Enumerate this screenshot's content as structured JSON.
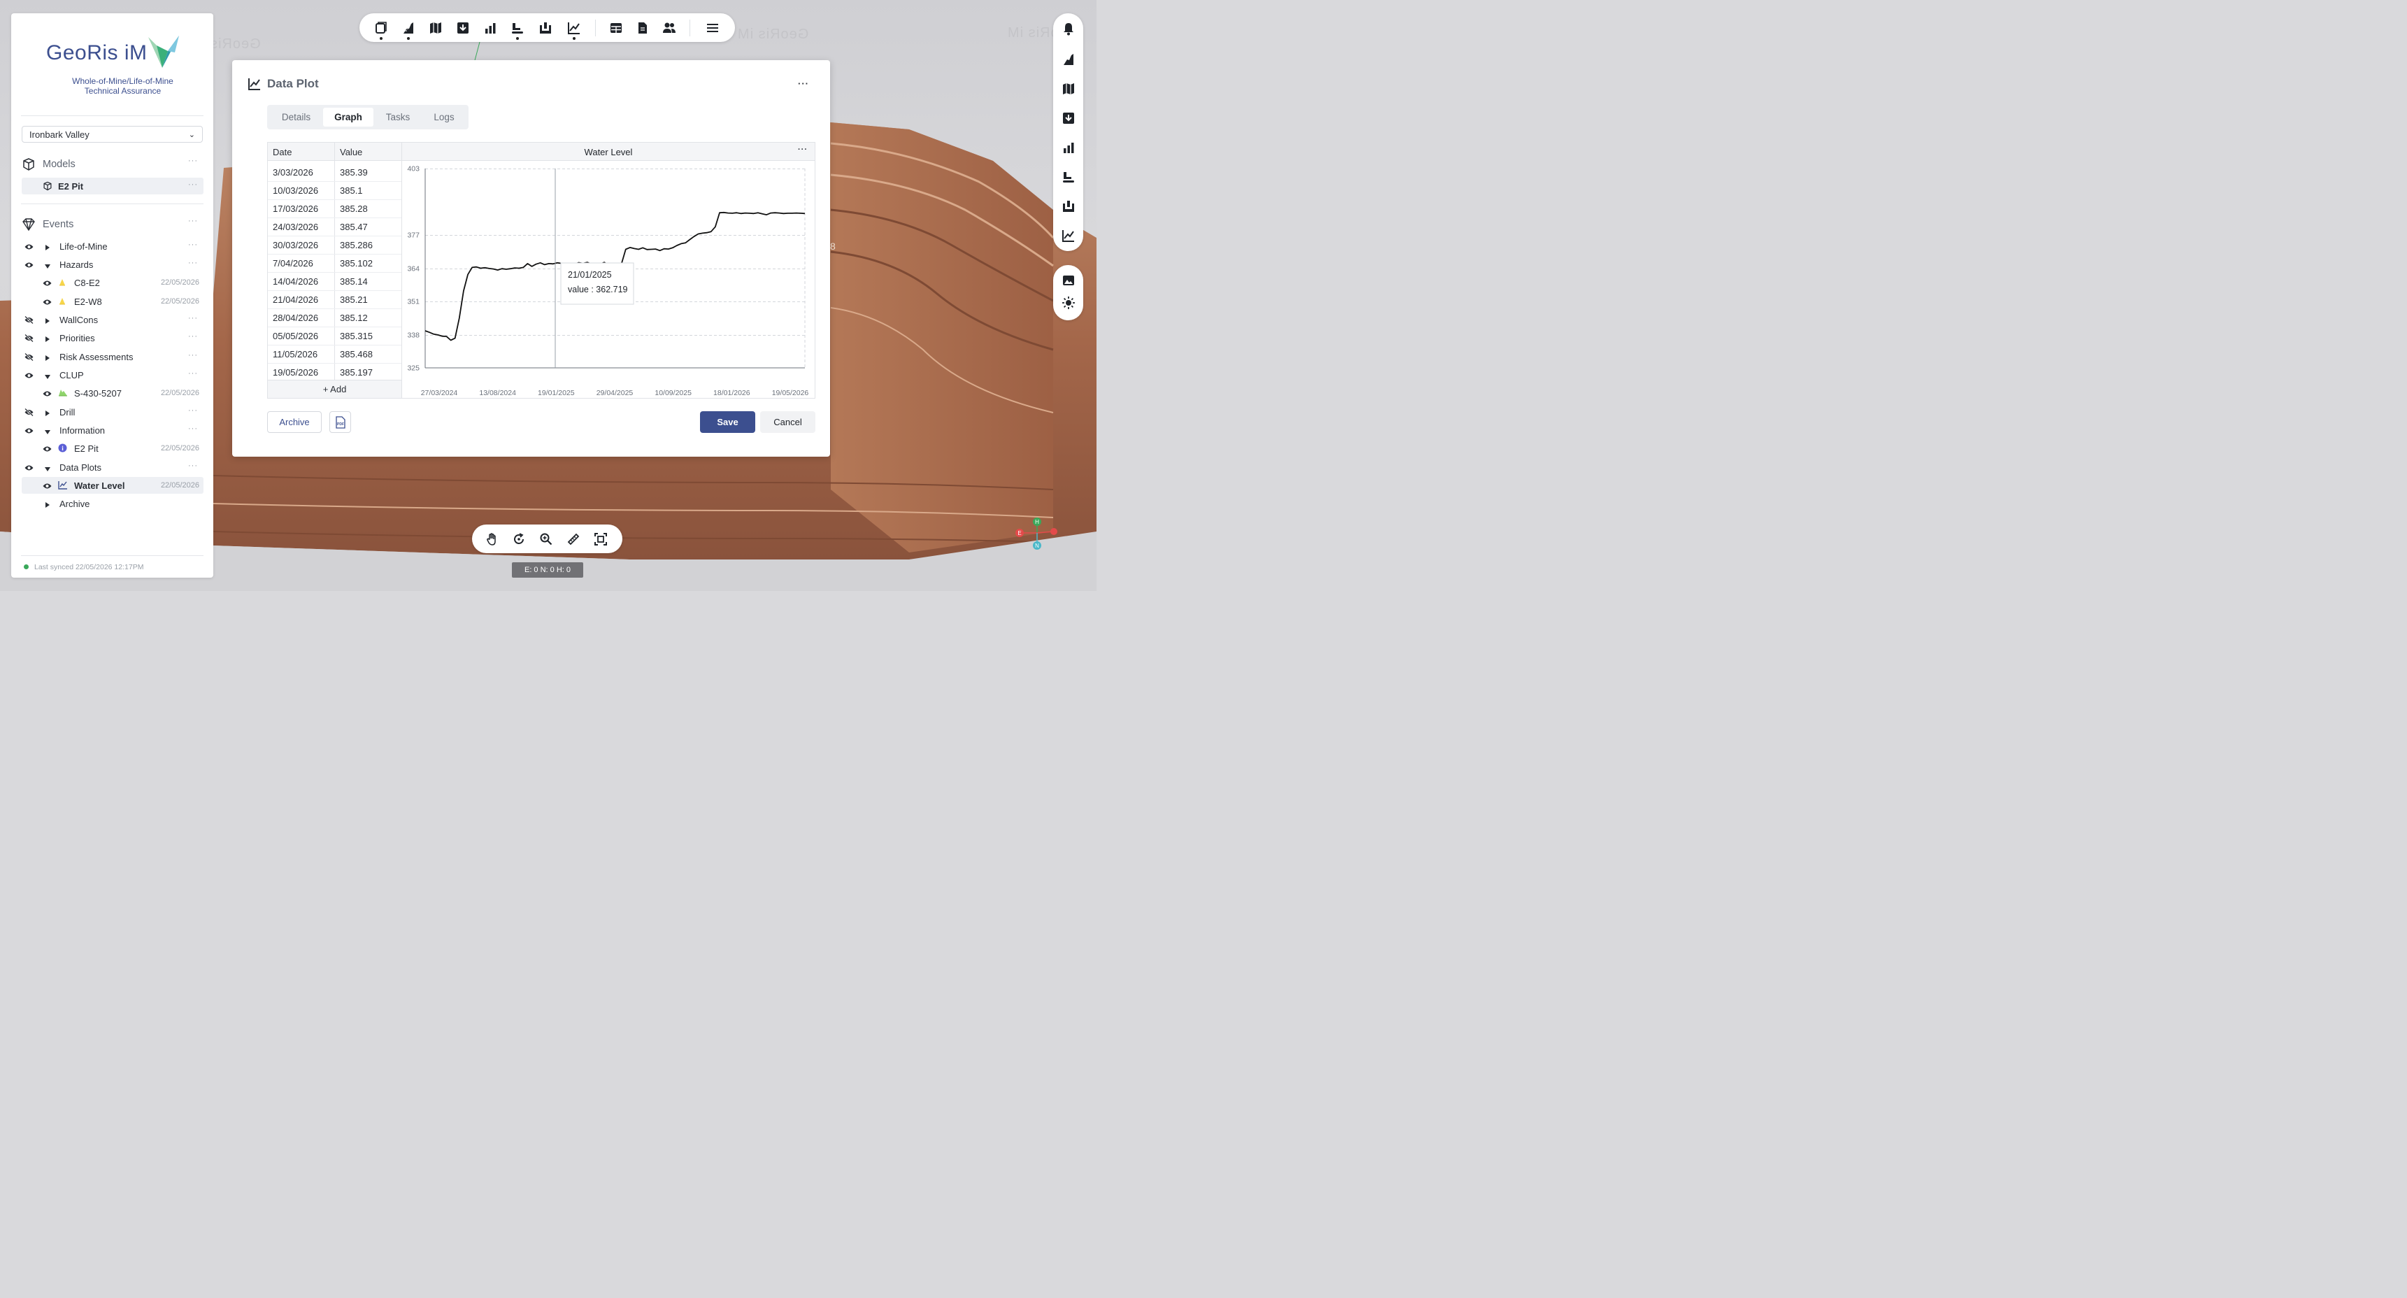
{
  "app": {
    "logo_text": "GeoRis iM",
    "tagline_1": "Whole-of-Mine/Life-of-Mine",
    "tagline_2": "Technical Assurance",
    "site": "Ironbark Valley",
    "last_synced": "Last synced 22/05/2026 12:17PM",
    "brand_color": "#3c4f8f"
  },
  "sidebar": {
    "models_label": "Models",
    "model_item": "E2 Pit",
    "events_label": "Events",
    "items": [
      {
        "label": "Life-of-Mine",
        "expanded": false,
        "visible": true
      },
      {
        "label": "Hazards",
        "expanded": true,
        "visible": true
      },
      {
        "label": "C8-E2",
        "date": "22/05/2026",
        "icon": "hazard-icon"
      },
      {
        "label": "E2-W8",
        "date": "22/05/2026",
        "icon": "hazard-icon"
      },
      {
        "label": "WallCons",
        "expanded": false,
        "visible": false
      },
      {
        "label": "Priorities",
        "expanded": false,
        "visible": false
      },
      {
        "label": "Risk Assessments",
        "expanded": false,
        "visible": false
      },
      {
        "label": "CLUP",
        "expanded": true,
        "visible": true
      },
      {
        "label": "S-430-5207",
        "date": "22/05/2026",
        "icon": "clup-icon"
      },
      {
        "label": "Drill",
        "expanded": false,
        "visible": false
      },
      {
        "label": "Information",
        "expanded": true,
        "visible": true
      },
      {
        "label": "E2 Pit",
        "date": "22/05/2026",
        "icon": "info-icon"
      },
      {
        "label": "Data Plots",
        "expanded": true,
        "visible": true
      },
      {
        "label": "Water Level",
        "date": "22/05/2026",
        "icon": "chart-line-icon"
      },
      {
        "label": "Archive",
        "expanded": false
      }
    ],
    "more": "···"
  },
  "modal": {
    "title": "Data Plot",
    "more": "···",
    "tabs": [
      "Details",
      "Graph",
      "Tasks",
      "Logs"
    ],
    "active_tab": "Graph",
    "table": {
      "headers": [
        "Date",
        "Value"
      ],
      "rows": [
        [
          "3/03/2026",
          "385.39"
        ],
        [
          "10/03/2026",
          "385.1"
        ],
        [
          "17/03/2026",
          "385.28"
        ],
        [
          "24/03/2026",
          "385.47"
        ],
        [
          "30/03/2026",
          "385.286"
        ],
        [
          "7/04/2026",
          "385.102"
        ],
        [
          "14/04/2026",
          "385.14"
        ],
        [
          "21/04/2026",
          "385.21"
        ],
        [
          "28/04/2026",
          "385.12"
        ],
        [
          "05/05/2026",
          "385.315"
        ],
        [
          "11/05/2026",
          "385.468"
        ],
        [
          "19/05/2026",
          "385.197"
        ]
      ],
      "add_label": "+ Add"
    },
    "archive_label": "Archive",
    "pdf_label": "PDF",
    "save_label": "Save",
    "cancel_label": "Cancel"
  },
  "chart_data": {
    "type": "line",
    "title": "Water Level",
    "more": "···",
    "xlabel": "",
    "ylabel": "",
    "ylim": [
      325,
      403
    ],
    "yticks": [
      "403",
      "377",
      "364",
      "351",
      "338",
      "325"
    ],
    "xticks": [
      "27/03/2024",
      "13/08/2024",
      "19/01/2025",
      "29/04/2025",
      "10/09/2025",
      "18/01/2026",
      "19/05/2026"
    ],
    "grid": true,
    "tooltip": {
      "date": "21/01/2025",
      "value_label": "value : 362.719"
    },
    "series": [
      {
        "values": [
          339.5,
          338.9,
          338.2,
          337.9,
          337.4,
          337.3,
          335.8,
          336.6,
          344.5,
          355.1,
          361.5,
          364.3,
          364.5,
          364.0,
          364.2,
          363.9,
          363.7,
          363.3,
          363.8,
          363.6,
          363.8,
          364.1,
          364.0,
          364.3,
          365.8,
          364.7,
          365.6,
          366.1,
          365.4,
          365.8,
          365.7,
          366.1,
          365.9,
          365.6,
          365.3,
          365.5,
          366.2,
          365.9,
          366.3,
          365.6,
          365.5,
          365.6,
          366.3,
          365.1,
          364.4,
          363.7,
          365.7,
          371.4,
          372.1,
          371.7,
          371.4,
          372.0,
          371.3,
          371.4,
          371.5,
          370.9,
          371.6,
          371.5,
          372.0,
          372.9,
          373.6,
          373.9,
          375.2,
          376.4,
          377.4,
          377.7,
          377.9,
          378.3,
          380.2,
          385.7,
          385.8,
          385.6,
          385.5,
          385.7,
          385.4,
          385.6,
          385.5,
          385.4,
          385.7,
          385.3,
          384.9,
          385.6,
          385.7,
          385.6,
          385.4,
          385.5,
          385.5,
          385.6,
          385.5,
          385.4
        ]
      }
    ]
  },
  "toolbar": {
    "top_icons": [
      "layers-icon",
      "wall-icon",
      "map-icon",
      "download-icon",
      "bar-chart-icon",
      "drill-rig-icon",
      "mine-icon",
      "line-chart-icon",
      "table-icon",
      "document-icon",
      "users-icon",
      "menu-icon"
    ],
    "right_icons": [
      "bell-icon",
      "wall-icon",
      "map-icon",
      "download-icon",
      "bar-chart-icon",
      "drill-rig-icon",
      "mine-icon",
      "line-chart-icon"
    ],
    "right_icons_2": [
      "image-icon",
      "sun-icon"
    ],
    "bottom_icons": [
      "hand-icon",
      "rotate-icon",
      "zoom-icon",
      "ruler-icon",
      "fit-icon"
    ],
    "coords": "E: 0   N: 0   H: 0"
  },
  "compass": {
    "h": "H",
    "e": "E",
    "n": "N"
  },
  "scene": {
    "pit_label": "8"
  }
}
